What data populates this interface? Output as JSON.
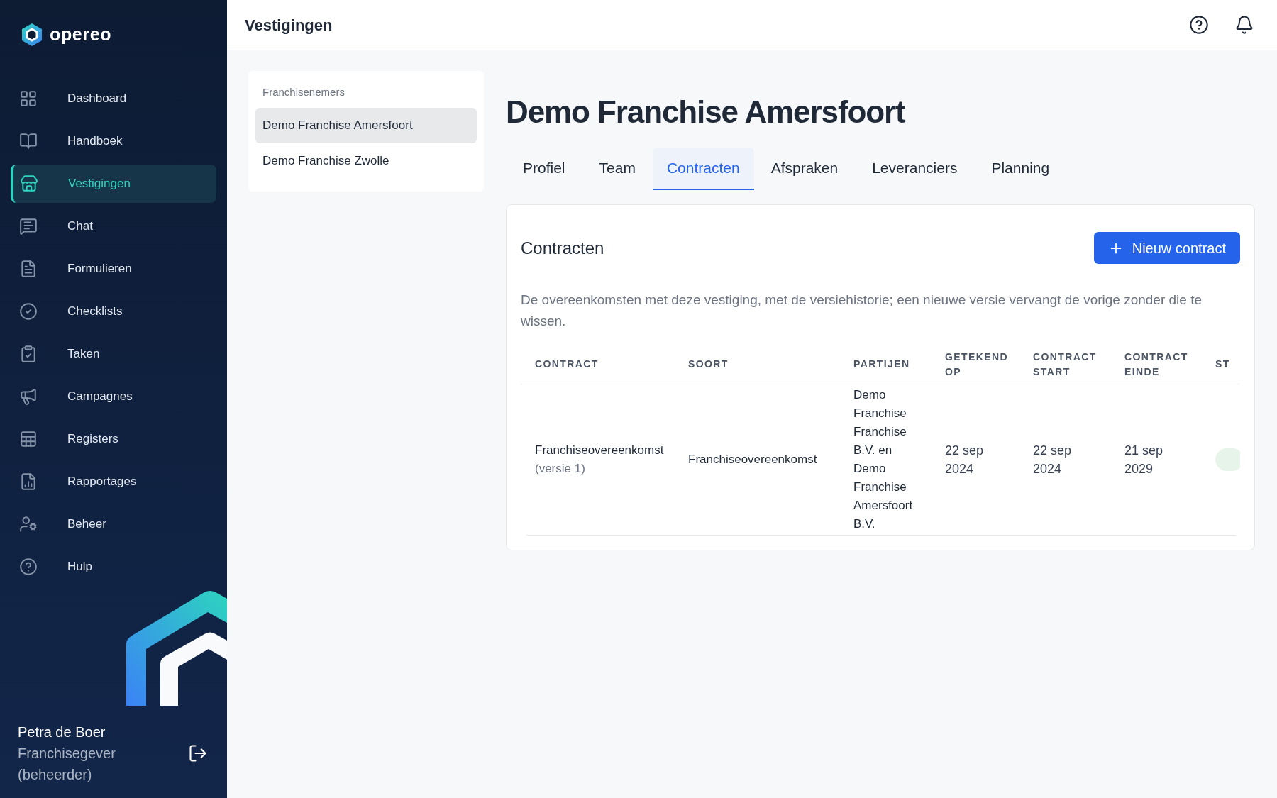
{
  "brand": "opereo",
  "nav": [
    {
      "label": "Dashboard",
      "selected": false
    },
    {
      "label": "Handboek",
      "selected": false
    },
    {
      "label": "Vestigingen",
      "selected": true
    },
    {
      "label": "Chat",
      "selected": false
    },
    {
      "label": "Formulieren",
      "selected": false
    },
    {
      "label": "Checklists",
      "selected": false
    },
    {
      "label": "Taken",
      "selected": false
    },
    {
      "label": "Campagnes",
      "selected": false
    },
    {
      "label": "Registers",
      "selected": false
    },
    {
      "label": "Rapportages",
      "selected": false
    },
    {
      "label": "Beheer",
      "selected": false
    },
    {
      "label": "Hulp",
      "selected": false
    }
  ],
  "user": {
    "name": "Petra de Boer",
    "role": "Franchisegever (beheerder)"
  },
  "header": {
    "title": "Vestigingen"
  },
  "franchisees": {
    "heading": "Franchisenemers",
    "items": [
      {
        "label": "Demo Franchise Amersfoort",
        "selected": true
      },
      {
        "label": "Demo Franchise Zwolle",
        "selected": false
      }
    ]
  },
  "page_title": "Demo Franchise Amersfoort",
  "tabs": [
    {
      "label": "Profiel",
      "selected": false
    },
    {
      "label": "Team",
      "selected": false
    },
    {
      "label": "Contracten",
      "selected": true
    },
    {
      "label": "Afspraken",
      "selected": false
    },
    {
      "label": "Leveranciers",
      "selected": false
    },
    {
      "label": "Planning",
      "selected": false
    }
  ],
  "card": {
    "title": "Contracten",
    "button": "Nieuw contract",
    "description": "De overeenkomsten met deze vestiging, met de versiehistorie; een nieuwe versie vervangt de vorige zonder die te wissen.",
    "table": {
      "columns": [
        "CONTRACT",
        "SOORT",
        "PARTIJEN",
        "GETEKEND OP",
        "CONTRACT START",
        "CONTRACT EINDE",
        "ST"
      ],
      "rows": [
        {
          "contract": "Franchiseovereenkomst",
          "version": "(versie 1)",
          "soort": "Franchiseovereenkomst",
          "partijen": "Demo Franchise Franchise B.V. en Demo Franchise Amersfoort B.V.",
          "getekend": "22 sep 2024",
          "start": "22 sep 2024",
          "einde": "21 sep 2029"
        }
      ]
    }
  }
}
